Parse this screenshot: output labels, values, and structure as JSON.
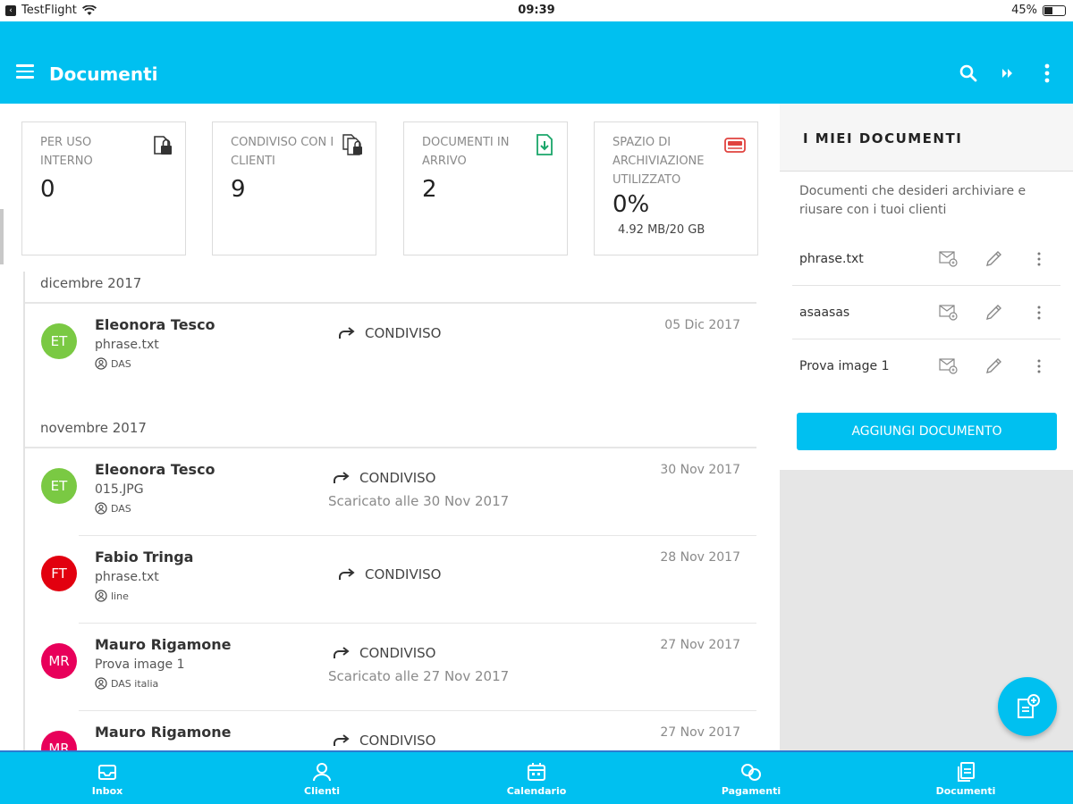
{
  "status_bar": {
    "carrier": "TestFlight",
    "time": "09:39",
    "battery": "45%",
    "battery_level": 0.45
  },
  "app_bar": {
    "title": "Documenti",
    "menu_icon": "hamburger-icon",
    "actions": [
      "search-icon",
      "forward-icon",
      "more-vertical-icon"
    ]
  },
  "colors": {
    "primary": "#00c0f0",
    "avatar_green": "#7ac943",
    "avatar_red": "#e2000f",
    "avatar_pink": "#e8005a"
  },
  "stats": [
    {
      "label": "PER USO INTERNO",
      "value": "0",
      "icon": "lock-document-icon"
    },
    {
      "label": "CONDIVISO CON I CLIENTI",
      "value": "9",
      "icon": "shared-lock-document-icon"
    },
    {
      "label": "DOCUMENTI IN ARRIVO",
      "value": "2",
      "icon": "download-document-icon"
    },
    {
      "label": "SPAZIO DI ARCHIVIAZIONE UTILIZZATO",
      "value": "0%",
      "sub": "4.92 MB/20 GB",
      "icon": "storage-icon"
    }
  ],
  "months": [
    "dicembre 2017",
    "novembre 2017"
  ],
  "entries": [
    {
      "initials": "ET",
      "name": "Eleonora Tesco",
      "file": "phrase.txt",
      "org": "DAS",
      "status": "CONDIVISO",
      "downloaded": "",
      "date": "05 Dic 2017"
    },
    {
      "initials": "ET",
      "name": "Eleonora Tesco",
      "file": "015.JPG",
      "org": "DAS",
      "status": "CONDIVISO",
      "downloaded": "Scaricato alle 30 Nov 2017",
      "date": "30 Nov 2017"
    },
    {
      "initials": "FT",
      "name": "Fabio Tringa",
      "file": "phrase.txt",
      "org": "line",
      "status": "CONDIVISO",
      "downloaded": "",
      "date": "28 Nov 2017"
    },
    {
      "initials": "MR",
      "name": "Mauro Rigamone",
      "file": "Prova image 1",
      "org": "DAS italia",
      "status": "CONDIVISO",
      "downloaded": "Scaricato alle 27 Nov 2017",
      "date": "27 Nov 2017"
    },
    {
      "initials": "MR",
      "name": "Mauro Rigamone",
      "file": "",
      "org": "",
      "status": "CONDIVISO",
      "downloaded": "",
      "date": "27 Nov 2017"
    }
  ],
  "my_documents": {
    "title": "I MIEI DOCUMENTI",
    "description": "Documenti che desideri archiviare e riusare con i tuoi clienti",
    "items": [
      "phrase.txt",
      "asaasas",
      "Prova image 1"
    ],
    "add_button": "AGGIUNGI DOCUMENTO"
  },
  "bottom_nav": [
    {
      "label": "Inbox",
      "icon": "inbox-icon"
    },
    {
      "label": "Clienti",
      "icon": "clients-icon"
    },
    {
      "label": "Calendario",
      "icon": "calendar-icon"
    },
    {
      "label": "Pagamenti",
      "icon": "payments-icon"
    },
    {
      "label": "Documenti",
      "icon": "documents-icon"
    }
  ]
}
